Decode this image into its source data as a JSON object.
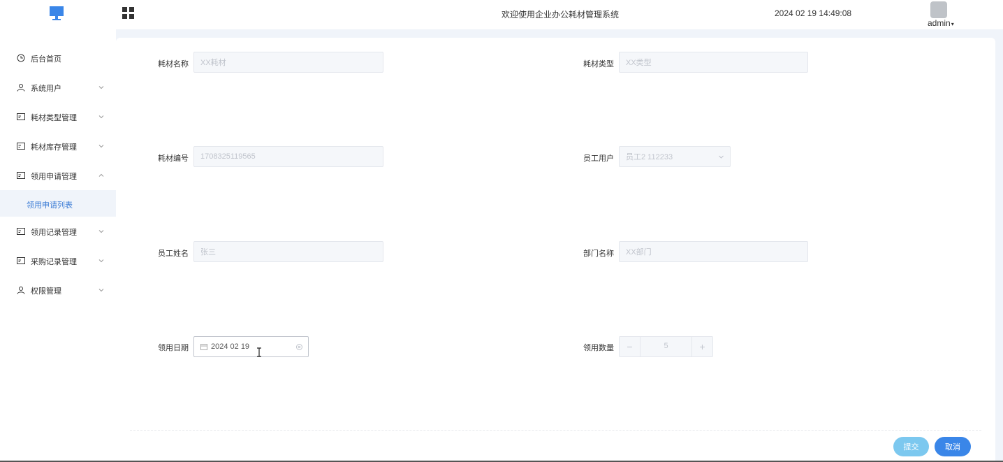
{
  "header": {
    "welcome": "欢迎使用企业办公耗材管理系统",
    "datetime": "2024 02 19 14:49:08",
    "user": "admin"
  },
  "sidebar": {
    "items": [
      {
        "label": "后台首页",
        "icon": "clock-icon",
        "has_arrow": false
      },
      {
        "label": "系统用户",
        "icon": "user-icon",
        "has_arrow": true,
        "arrow": "down"
      },
      {
        "label": "耗材类型管理",
        "icon": "card-icon",
        "has_arrow": true,
        "arrow": "down"
      },
      {
        "label": "耗材库存管理",
        "icon": "card-icon",
        "has_arrow": true,
        "arrow": "down"
      },
      {
        "label": "领用申请管理",
        "icon": "card-icon",
        "has_arrow": true,
        "arrow": "up"
      },
      {
        "label": "领用记录管理",
        "icon": "card-icon",
        "has_arrow": true,
        "arrow": "down"
      },
      {
        "label": "采购记录管理",
        "icon": "card-icon",
        "has_arrow": true,
        "arrow": "down"
      },
      {
        "label": "权限管理",
        "icon": "user-icon",
        "has_arrow": true,
        "arrow": "down"
      }
    ],
    "active_sub": "领用申请列表"
  },
  "form": {
    "fields": {
      "consumable_name": {
        "label": "耗材名称",
        "placeholder": "XX耗材"
      },
      "consumable_type": {
        "label": "耗材类型",
        "placeholder": "XX类型"
      },
      "consumable_code": {
        "label": "耗材编号",
        "placeholder": "1708325119565"
      },
      "employee_user": {
        "label": "员工用户",
        "placeholder": "员工2 112233"
      },
      "employee_name": {
        "label": "员工姓名",
        "placeholder": "张三"
      },
      "department": {
        "label": "部门名称",
        "placeholder": "XX部门"
      },
      "apply_date": {
        "label": "领用日期",
        "value": "2024 02 19"
      },
      "quantity": {
        "label": "领用数量",
        "value": "5"
      }
    },
    "submit_label": "提交",
    "cancel_label": "取消"
  },
  "colors": {
    "primary": "#3a86e8",
    "submit": "#7cc8ef",
    "active_text": "#3a7bd5"
  }
}
